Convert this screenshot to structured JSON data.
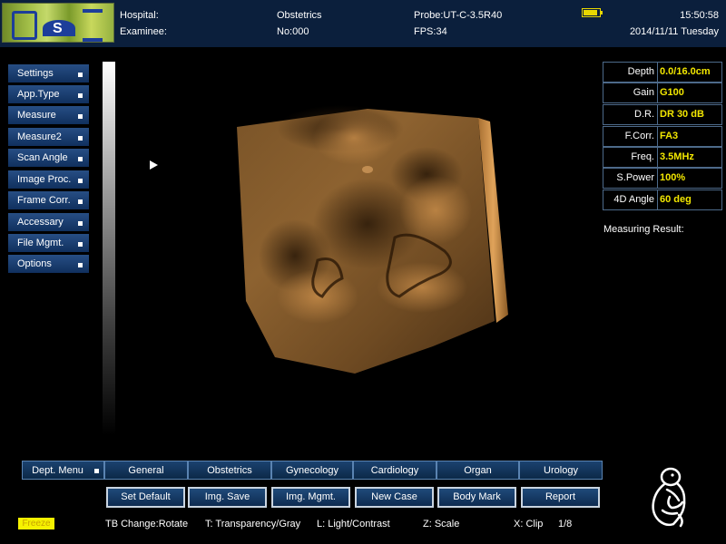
{
  "header": {
    "hospital_label": "Hospital:",
    "examinee_label": "Examinee:",
    "exam_type": "Obstetrics",
    "patient_no": "No:000",
    "probe": "Probe:UT-C-3.5R40",
    "fps": "FPS:34",
    "time": "15:50:58",
    "date": "2014/11/11 Tuesday",
    "battery_level": 0.9,
    "battery_icon": "battery-icon",
    "logo_icon": "brand-logo"
  },
  "left_menu": [
    {
      "label": "Settings"
    },
    {
      "label": "App.Type"
    },
    {
      "label": "Measure"
    },
    {
      "label": "Measure2"
    },
    {
      "label": "Scan Angle"
    },
    {
      "label": "Image Proc."
    },
    {
      "label": "Frame Corr."
    },
    {
      "label": "Accessary"
    },
    {
      "label": "File Mgmt."
    },
    {
      "label": "Options"
    }
  ],
  "params": [
    {
      "name": "Depth",
      "value": "0.0/16.0cm"
    },
    {
      "name": "Gain",
      "value": "G100"
    },
    {
      "name": "D.R.",
      "value": "DR 30 dB"
    },
    {
      "name": "F.Corr.",
      "value": "FA3"
    },
    {
      "name": "Freq.",
      "value": "3.5MHz"
    },
    {
      "name": "S.Power",
      "value": "100%"
    },
    {
      "name": "4D Angle",
      "value": "60 deg"
    }
  ],
  "measuring_result_label": "Measuring Result:",
  "dept_tabs": [
    {
      "label": "Dept. Menu"
    },
    {
      "label": "General"
    },
    {
      "label": "Obstetrics"
    },
    {
      "label": "Gynecology"
    },
    {
      "label": "Cardiology"
    },
    {
      "label": "Organ"
    },
    {
      "label": "Urology"
    }
  ],
  "function_buttons": [
    {
      "label": "Set Default"
    },
    {
      "label": "Img. Save"
    },
    {
      "label": "Img. Mgmt."
    },
    {
      "label": "New Case"
    },
    {
      "label": "Body Mark"
    },
    {
      "label": "Report"
    }
  ],
  "status": {
    "freeze": "Freeze",
    "tb_change": "TB Change:Rotate",
    "t_key": "T: Transparency/Gray",
    "l_key": "L: Light/Contrast",
    "z_key": "Z: Scale",
    "x_key": "X: Clip",
    "page": "1/8"
  },
  "colors": {
    "header_bg": "#0b1f3c",
    "value_yellow": "#f2e700",
    "render_tone": "#b07a3a"
  },
  "icons": {
    "cursor": "pointer-arrow-icon",
    "body_mark": "fetus-body-mark-icon"
  }
}
